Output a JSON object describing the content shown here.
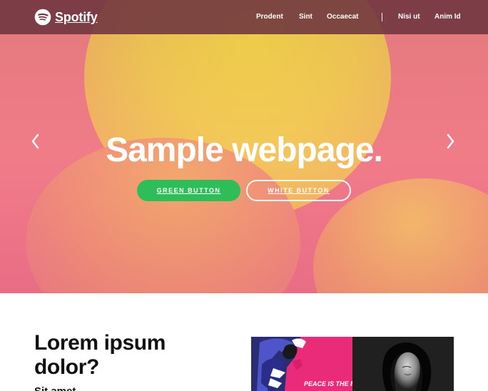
{
  "header": {
    "brand": "Spotify",
    "logo_icon": "spotify-logo-icon",
    "nav_items": [
      {
        "label": "Prodent"
      },
      {
        "label": "Sint"
      },
      {
        "label": "Occaecat"
      },
      {
        "label": "Nisi ut"
      },
      {
        "label": "Anim Id"
      }
    ],
    "colors": {
      "background": "#6e343f",
      "text": "#ffffff"
    }
  },
  "hero": {
    "title": "Sample webpage.",
    "left_arrow_icon": "chevron-left-icon",
    "right_arrow_icon": "chevron-right-icon",
    "buttons": {
      "green": "GREEN BUTTON",
      "white": "WHITE BUTTON"
    },
    "colors": {
      "green_button": "#2ebd59",
      "text": "#ffffff",
      "background_pink": "#f07a86",
      "background_yellow": "#f7d64a"
    }
  },
  "content": {
    "title": "Lorem ipsum dolor?",
    "subtitle": "Sit amet",
    "album_strip": {
      "first_album_text": "PEACE IS THE MISSION"
    }
  }
}
